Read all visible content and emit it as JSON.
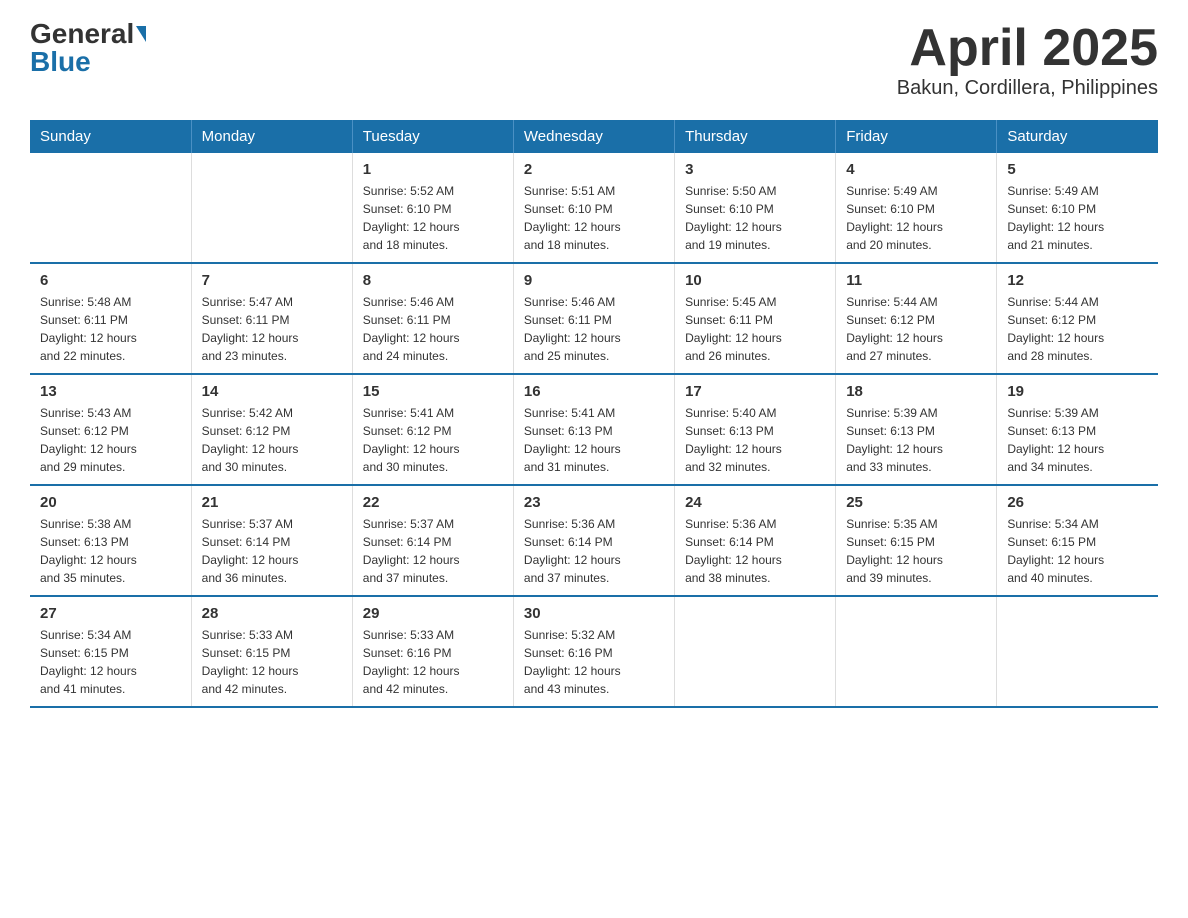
{
  "logo": {
    "general": "General",
    "blue": "Blue"
  },
  "title": "April 2025",
  "subtitle": "Bakun, Cordillera, Philippines",
  "days_header": [
    "Sunday",
    "Monday",
    "Tuesday",
    "Wednesday",
    "Thursday",
    "Friday",
    "Saturday"
  ],
  "weeks": [
    [
      {
        "day": "",
        "info": ""
      },
      {
        "day": "",
        "info": ""
      },
      {
        "day": "1",
        "info": "Sunrise: 5:52 AM\nSunset: 6:10 PM\nDaylight: 12 hours\nand 18 minutes."
      },
      {
        "day": "2",
        "info": "Sunrise: 5:51 AM\nSunset: 6:10 PM\nDaylight: 12 hours\nand 18 minutes."
      },
      {
        "day": "3",
        "info": "Sunrise: 5:50 AM\nSunset: 6:10 PM\nDaylight: 12 hours\nand 19 minutes."
      },
      {
        "day": "4",
        "info": "Sunrise: 5:49 AM\nSunset: 6:10 PM\nDaylight: 12 hours\nand 20 minutes."
      },
      {
        "day": "5",
        "info": "Sunrise: 5:49 AM\nSunset: 6:10 PM\nDaylight: 12 hours\nand 21 minutes."
      }
    ],
    [
      {
        "day": "6",
        "info": "Sunrise: 5:48 AM\nSunset: 6:11 PM\nDaylight: 12 hours\nand 22 minutes."
      },
      {
        "day": "7",
        "info": "Sunrise: 5:47 AM\nSunset: 6:11 PM\nDaylight: 12 hours\nand 23 minutes."
      },
      {
        "day": "8",
        "info": "Sunrise: 5:46 AM\nSunset: 6:11 PM\nDaylight: 12 hours\nand 24 minutes."
      },
      {
        "day": "9",
        "info": "Sunrise: 5:46 AM\nSunset: 6:11 PM\nDaylight: 12 hours\nand 25 minutes."
      },
      {
        "day": "10",
        "info": "Sunrise: 5:45 AM\nSunset: 6:11 PM\nDaylight: 12 hours\nand 26 minutes."
      },
      {
        "day": "11",
        "info": "Sunrise: 5:44 AM\nSunset: 6:12 PM\nDaylight: 12 hours\nand 27 minutes."
      },
      {
        "day": "12",
        "info": "Sunrise: 5:44 AM\nSunset: 6:12 PM\nDaylight: 12 hours\nand 28 minutes."
      }
    ],
    [
      {
        "day": "13",
        "info": "Sunrise: 5:43 AM\nSunset: 6:12 PM\nDaylight: 12 hours\nand 29 minutes."
      },
      {
        "day": "14",
        "info": "Sunrise: 5:42 AM\nSunset: 6:12 PM\nDaylight: 12 hours\nand 30 minutes."
      },
      {
        "day": "15",
        "info": "Sunrise: 5:41 AM\nSunset: 6:12 PM\nDaylight: 12 hours\nand 30 minutes."
      },
      {
        "day": "16",
        "info": "Sunrise: 5:41 AM\nSunset: 6:13 PM\nDaylight: 12 hours\nand 31 minutes."
      },
      {
        "day": "17",
        "info": "Sunrise: 5:40 AM\nSunset: 6:13 PM\nDaylight: 12 hours\nand 32 minutes."
      },
      {
        "day": "18",
        "info": "Sunrise: 5:39 AM\nSunset: 6:13 PM\nDaylight: 12 hours\nand 33 minutes."
      },
      {
        "day": "19",
        "info": "Sunrise: 5:39 AM\nSunset: 6:13 PM\nDaylight: 12 hours\nand 34 minutes."
      }
    ],
    [
      {
        "day": "20",
        "info": "Sunrise: 5:38 AM\nSunset: 6:13 PM\nDaylight: 12 hours\nand 35 minutes."
      },
      {
        "day": "21",
        "info": "Sunrise: 5:37 AM\nSunset: 6:14 PM\nDaylight: 12 hours\nand 36 minutes."
      },
      {
        "day": "22",
        "info": "Sunrise: 5:37 AM\nSunset: 6:14 PM\nDaylight: 12 hours\nand 37 minutes."
      },
      {
        "day": "23",
        "info": "Sunrise: 5:36 AM\nSunset: 6:14 PM\nDaylight: 12 hours\nand 37 minutes."
      },
      {
        "day": "24",
        "info": "Sunrise: 5:36 AM\nSunset: 6:14 PM\nDaylight: 12 hours\nand 38 minutes."
      },
      {
        "day": "25",
        "info": "Sunrise: 5:35 AM\nSunset: 6:15 PM\nDaylight: 12 hours\nand 39 minutes."
      },
      {
        "day": "26",
        "info": "Sunrise: 5:34 AM\nSunset: 6:15 PM\nDaylight: 12 hours\nand 40 minutes."
      }
    ],
    [
      {
        "day": "27",
        "info": "Sunrise: 5:34 AM\nSunset: 6:15 PM\nDaylight: 12 hours\nand 41 minutes."
      },
      {
        "day": "28",
        "info": "Sunrise: 5:33 AM\nSunset: 6:15 PM\nDaylight: 12 hours\nand 42 minutes."
      },
      {
        "day": "29",
        "info": "Sunrise: 5:33 AM\nSunset: 6:16 PM\nDaylight: 12 hours\nand 42 minutes."
      },
      {
        "day": "30",
        "info": "Sunrise: 5:32 AM\nSunset: 6:16 PM\nDaylight: 12 hours\nand 43 minutes."
      },
      {
        "day": "",
        "info": ""
      },
      {
        "day": "",
        "info": ""
      },
      {
        "day": "",
        "info": ""
      }
    ]
  ]
}
